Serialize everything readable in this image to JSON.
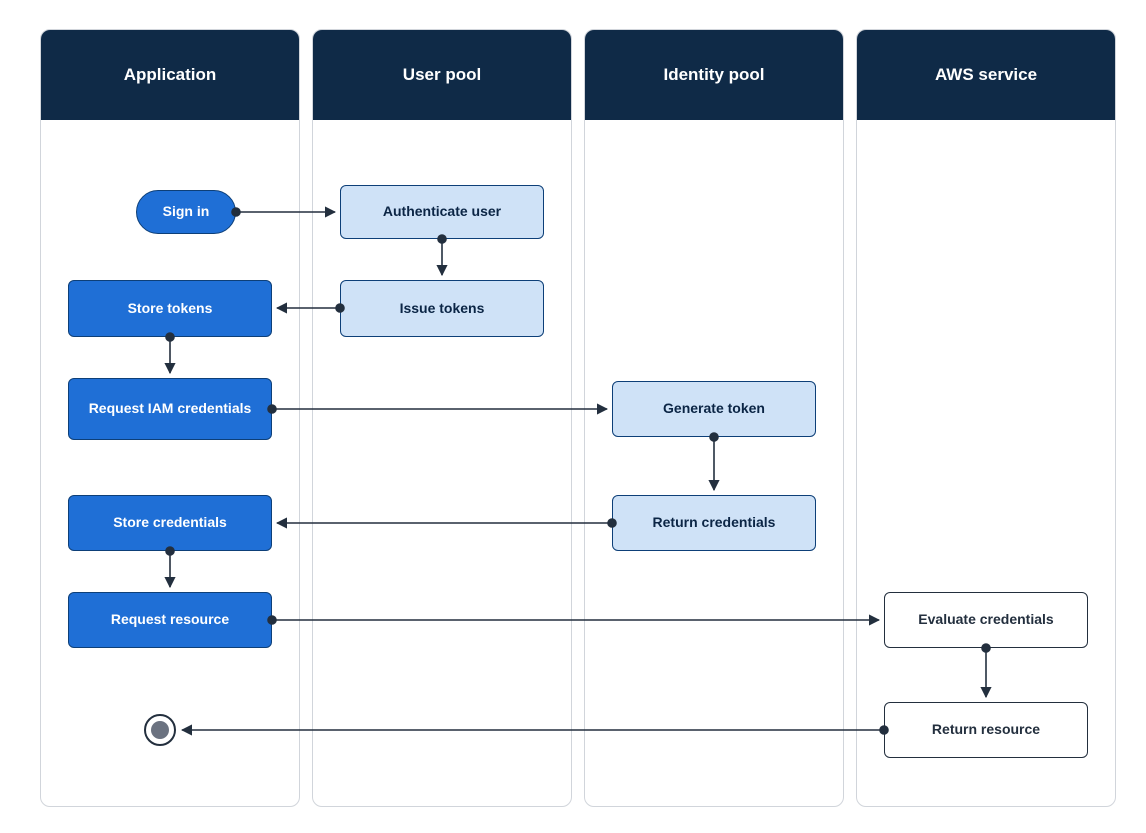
{
  "lanes": {
    "application": "Application",
    "user_pool": "User pool",
    "identity_pool": "Identity pool",
    "aws_service": "AWS service"
  },
  "nodes": {
    "sign_in": "Sign in",
    "authenticate_user": "Authenticate user",
    "issue_tokens": "Issue tokens",
    "store_tokens": "Store tokens",
    "request_iam": "Request IAM credentials",
    "generate_token": "Generate token",
    "return_credentials": "Return credentials",
    "store_credentials": "Store credentials",
    "request_resource": "Request resource",
    "evaluate_credentials": "Evaluate credentials",
    "return_resource": "Return resource"
  },
  "chart_data": {
    "type": "diagram",
    "diagram_type": "swimlane-activity",
    "lanes": [
      "Application",
      "User pool",
      "Identity pool",
      "AWS service"
    ],
    "start": "Sign in",
    "end": "endpoint",
    "nodes": [
      {
        "id": "sign_in",
        "lane": "Application",
        "label": "Sign in",
        "kind": "start"
      },
      {
        "id": "authenticate_user",
        "lane": "User pool",
        "label": "Authenticate user",
        "kind": "process"
      },
      {
        "id": "issue_tokens",
        "lane": "User pool",
        "label": "Issue tokens",
        "kind": "process"
      },
      {
        "id": "store_tokens",
        "lane": "Application",
        "label": "Store tokens",
        "kind": "process"
      },
      {
        "id": "request_iam",
        "lane": "Application",
        "label": "Request IAM credentials",
        "kind": "process"
      },
      {
        "id": "generate_token",
        "lane": "Identity pool",
        "label": "Generate token",
        "kind": "process"
      },
      {
        "id": "return_credentials",
        "lane": "Identity pool",
        "label": "Return credentials",
        "kind": "process"
      },
      {
        "id": "store_credentials",
        "lane": "Application",
        "label": "Store credentials",
        "kind": "process"
      },
      {
        "id": "request_resource",
        "lane": "Application",
        "label": "Request resource",
        "kind": "process"
      },
      {
        "id": "evaluate_credentials",
        "lane": "AWS service",
        "label": "Evaluate credentials",
        "kind": "process"
      },
      {
        "id": "return_resource",
        "lane": "AWS service",
        "label": "Return resource",
        "kind": "process"
      },
      {
        "id": "endpoint",
        "lane": "Application",
        "label": "",
        "kind": "end"
      }
    ],
    "edges": [
      [
        "sign_in",
        "authenticate_user"
      ],
      [
        "authenticate_user",
        "issue_tokens"
      ],
      [
        "issue_tokens",
        "store_tokens"
      ],
      [
        "store_tokens",
        "request_iam"
      ],
      [
        "request_iam",
        "generate_token"
      ],
      [
        "generate_token",
        "return_credentials"
      ],
      [
        "return_credentials",
        "store_credentials"
      ],
      [
        "store_credentials",
        "request_resource"
      ],
      [
        "request_resource",
        "evaluate_credentials"
      ],
      [
        "evaluate_credentials",
        "return_resource"
      ],
      [
        "return_resource",
        "endpoint"
      ]
    ]
  }
}
